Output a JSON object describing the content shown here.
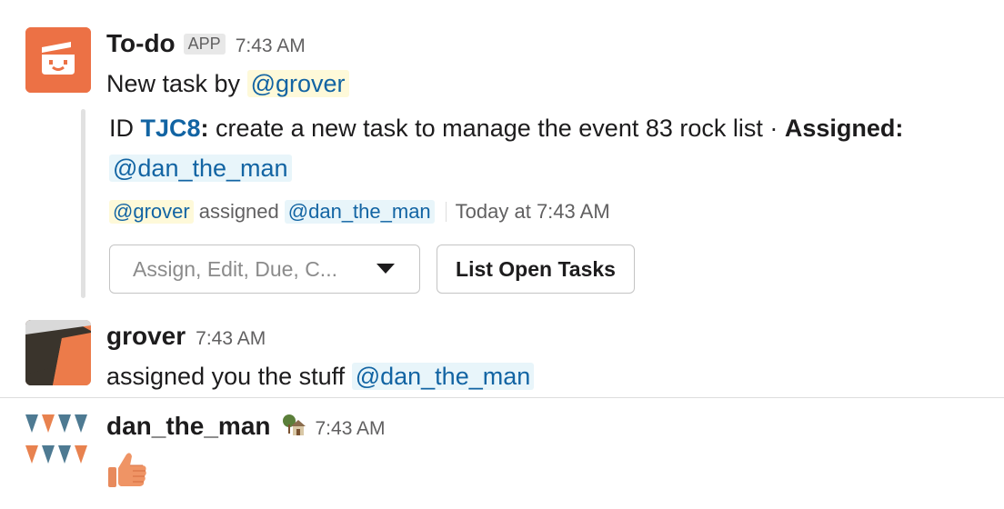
{
  "messages": [
    {
      "sender": "To-do",
      "badge": "APP",
      "time": "7:43 AM",
      "text_prefix": "New task by",
      "mention": "@grover",
      "attachment": {
        "id_label": "ID",
        "task_id": "TJC8",
        "colon": ":",
        "description": " create a new task to manage the event 83 rock list · ",
        "assigned_label": "Assigned:",
        "assignee": "@dan_the_man",
        "context": {
          "actor": "@grover",
          "verb": "assigned",
          "target": "@dan_the_man",
          "timestamp": "Today at 7:43 AM"
        },
        "select_placeholder": "Assign, Edit, Due, C...",
        "button_label": "List Open Tasks"
      }
    },
    {
      "sender": "grover",
      "time": "7:43 AM",
      "text": "assigned you the stuff",
      "mention": "@dan_the_man"
    },
    {
      "sender": "dan_the_man",
      "status_icon": "house-with-tree-icon",
      "time": "7:43 AM",
      "reaction_icon": "thumbs-up-icon"
    }
  ],
  "colors": {
    "todo_brand": "#ec7145",
    "link": "#1264a3",
    "mention_bg": "#e8f5fa",
    "self_mention_bg": "#fef9d9"
  }
}
